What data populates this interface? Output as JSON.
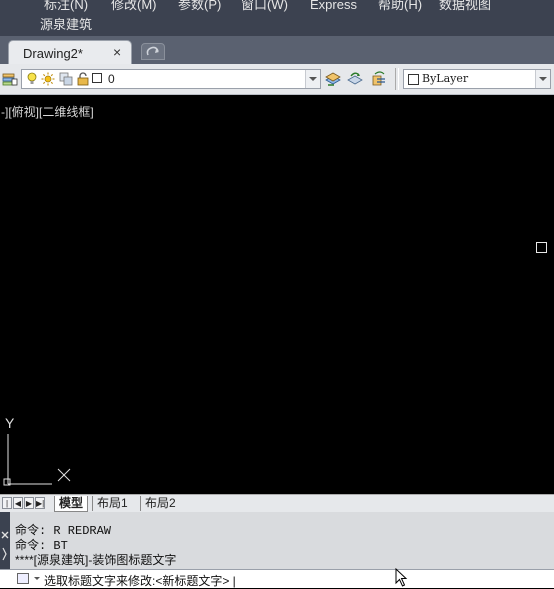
{
  "menubar": {
    "items": [
      "标注(N)",
      "修改(M)",
      "参数(P)",
      "窗口(W)",
      "Express",
      "帮助(H)",
      "数据视图"
    ],
    "second_row": "源泉建筑"
  },
  "file_tabs": {
    "active_label": "Drawing2*",
    "close_glyph": "×"
  },
  "layer_toolbar": {
    "current_layer": "0",
    "color_value": "ByLayer"
  },
  "viewport": {
    "label": "-][俯视][二维线框]",
    "ucs_y": "Y"
  },
  "layout_tabs": {
    "tabs": [
      "模型",
      "布局1",
      "布局2"
    ],
    "active": "模型"
  },
  "command": {
    "history": [
      "命令: R REDRAW",
      "命令: BT",
      "****[源泉建筑]-装饰图标题文字"
    ],
    "prompt": "选取标题文字来修改:<新标题文字> |"
  }
}
